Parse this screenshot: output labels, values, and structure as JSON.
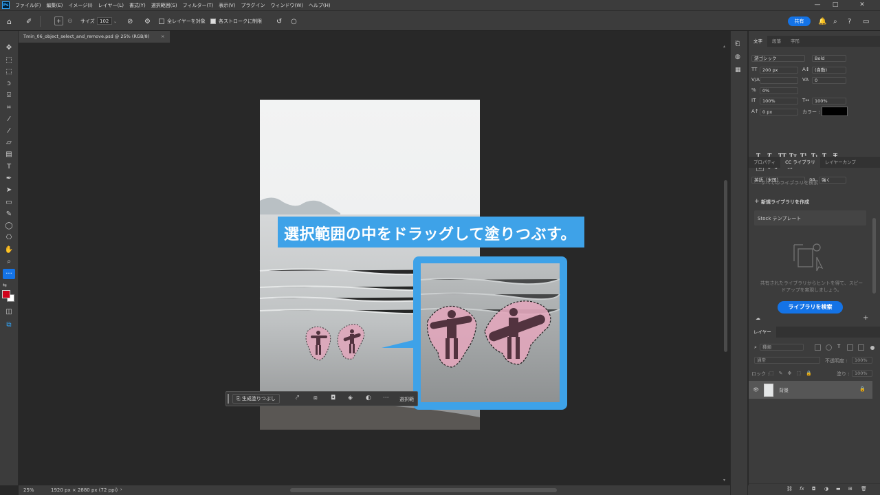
{
  "app": {
    "logo": "Ps"
  },
  "menu": {
    "items": [
      "ファイル(F)",
      "編集(E)",
      "イメージ(I)",
      "レイヤー(L)",
      "書式(Y)",
      "選択範囲(S)",
      "フィルター(T)",
      "表示(V)",
      "プラグイン",
      "ウィンドウ(W)",
      "ヘルプ(H)"
    ]
  },
  "window": {
    "minimize": "—",
    "maximize": "□",
    "close": "✕"
  },
  "options": {
    "size_label": "サイズ",
    "size_value": "102",
    "sample_all_layers": "全レイヤーを対象",
    "auto_enhance": "各ストロークに制限",
    "share_button": "共有"
  },
  "document": {
    "tab_title": "Tmin_06_object_select_and_remove.psd @ 25% (RGB/8)",
    "close": "×"
  },
  "canvas": {
    "callout_text": "選択範囲の中をドラッグして塗りつぶす。",
    "accent_color": "#3ea2e8"
  },
  "contextbar": {
    "generative_fill": "生成塗りつぶし",
    "more": "···",
    "select_label": "選択範"
  },
  "status": {
    "zoom": "25%",
    "doc_info": "1920 px × 2880 px (72 ppi)",
    "arrow": "›"
  },
  "character_panel": {
    "tabs": [
      "文字",
      "段落",
      "字形"
    ],
    "font_family": "游ゴシック",
    "font_style": "Bold",
    "size": "200 px",
    "leading": "(自動)",
    "kerning": "",
    "tracking": "0",
    "tsume": "0%",
    "vscale": "100%",
    "hscale": "100%",
    "baseline": "0 px",
    "color_label": "カラー :",
    "text_color": "#000000",
    "language": "英語（米国）",
    "antialias": "強く",
    "aa_label": "aa"
  },
  "libraries_panel": {
    "tabs": [
      "プロパティ",
      "CC ライブラリ",
      "レイヤーカンプ"
    ],
    "search_placeholder": "すべてのライブラリを検索",
    "create_new": "新規ライブラリを作成",
    "stock_templates": "Stock テンプレート",
    "empty_message": "共有されたライブラリからヒントを得て、スピードアップを実現しましょう。",
    "search_button": "ライブラリを検索"
  },
  "layers_panel": {
    "tab": "レイヤー",
    "filter_kind": "種類",
    "blend_mode": "通常",
    "opacity_label": "不透明度 :",
    "opacity_value": "100%",
    "lock_label": "ロック :",
    "fill_label": "塗り :",
    "fill_value": "100%",
    "layers": [
      {
        "name": "背景",
        "visible": true,
        "locked": true
      }
    ]
  }
}
